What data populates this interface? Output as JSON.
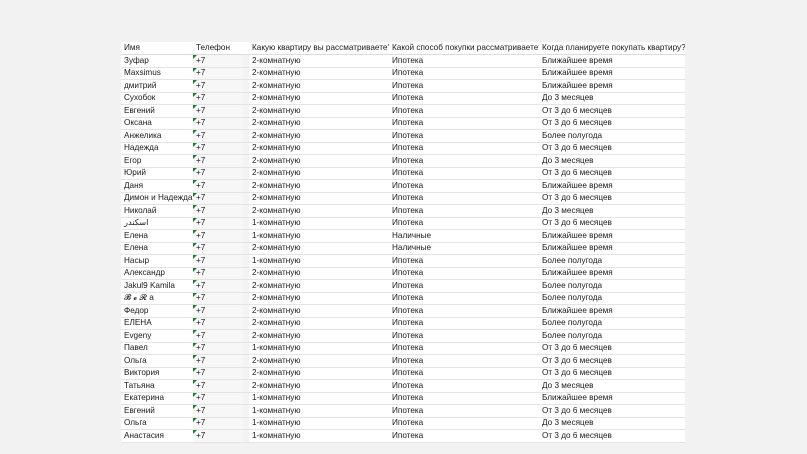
{
  "headers": {
    "name": "Имя",
    "phone": "Телефон",
    "apartment": "Какую квартиру вы рассматриваете?",
    "method": "Какой способ покупки рассматриваете?",
    "when": "Когда планируете покупать квартиру?"
  },
  "rows": [
    {
      "name": "Зуфар",
      "phone": "+7",
      "apartment": "2-комнатную",
      "method": "Ипотека",
      "when": "Ближайшее время"
    },
    {
      "name": "Maxsimus",
      "phone": "+7",
      "apartment": "2-комнатную",
      "method": "Ипотека",
      "when": "Ближайшее время"
    },
    {
      "name": "дмитрий",
      "phone": "+7",
      "apartment": "2-комнатную",
      "method": "Ипотека",
      "when": "Ближайшее время"
    },
    {
      "name": "Сухобок",
      "phone": "+7",
      "apartment": "2-комнатную",
      "method": "Ипотека",
      "when": "До 3 месяцев"
    },
    {
      "name": "Евгений",
      "phone": "+7",
      "apartment": "2-комнатную",
      "method": "Ипотека",
      "when": "От 3 до 6 месяцев"
    },
    {
      "name": "Оксана",
      "phone": "+7",
      "apartment": "2-комнатную",
      "method": "Ипотека",
      "when": "От 3 до 6 месяцев"
    },
    {
      "name": "Анжелика",
      "phone": "+7",
      "apartment": "2-комнатную",
      "method": "Ипотека",
      "when": "Более полугода"
    },
    {
      "name": "Надежда",
      "phone": "+7",
      "apartment": "2-комнатную",
      "method": "Ипотека",
      "when": "От 3 до 6 месяцев"
    },
    {
      "name": "Егор",
      "phone": "+7",
      "apartment": "2-комнатную",
      "method": "Ипотека",
      "when": "До 3 месяцев"
    },
    {
      "name": "Юрий",
      "phone": "+7",
      "apartment": "2-комнатную",
      "method": "Ипотека",
      "when": "От 3 до 6 месяцев"
    },
    {
      "name": "Даня",
      "phone": "+7",
      "apartment": "2-комнатную",
      "method": "Ипотека",
      "when": "Ближайшее время"
    },
    {
      "name": "Димон и Надежда",
      "phone": "+7",
      "apartment": "2-комнатную",
      "method": "Ипотека",
      "when": "От 3 до 6 месяцев"
    },
    {
      "name": "Николай",
      "phone": "+7",
      "apartment": "2-комнатную",
      "method": "Ипотека",
      "when": "До 3 месяцев"
    },
    {
      "name": "اسكندر",
      "phone": "+7",
      "apartment": "1-комнатную",
      "method": "Ипотека",
      "when": "От 3 до 6 месяцев",
      "rtl": true
    },
    {
      "name": "Елена",
      "phone": "+7",
      "apartment": "1-комнатную",
      "method": "Наличные",
      "when": "Ближайшее время"
    },
    {
      "name": "Елена",
      "phone": "+7",
      "apartment": "2-комнатную",
      "method": "Наличные",
      "when": "Ближайшее время"
    },
    {
      "name": "Насыр",
      "phone": "+7",
      "apartment": "1-комнатную",
      "method": "Ипотека",
      "when": "Более полугода"
    },
    {
      "name": "Александр",
      "phone": "+7",
      "apartment": "2-комнатную",
      "method": "Ипотека",
      "when": "Ближайшее время"
    },
    {
      "name": "Jakul9 Kamila",
      "phone": "+7",
      "apartment": "2-комнатную",
      "method": "Ипотека",
      "when": "Более полугода"
    },
    {
      "name": "𝓑 𝓮 𝓡 a",
      "phone": "+7",
      "apartment": "2-комнатную",
      "method": "Ипотека",
      "when": "Более полугода"
    },
    {
      "name": "Федор",
      "phone": "+7",
      "apartment": "2-комнатную",
      "method": "Ипотека",
      "when": "Ближайшее время"
    },
    {
      "name": "ЕЛЕНА",
      "phone": "+7",
      "apartment": "2-комнатную",
      "method": "Ипотека",
      "when": "Более полугода"
    },
    {
      "name": "Evgeny",
      "phone": "+7",
      "apartment": "2-комнатную",
      "method": "Ипотека",
      "when": "Более полугода"
    },
    {
      "name": "Павел",
      "phone": "+7",
      "apartment": "1-комнатную",
      "method": "Ипотека",
      "when": "От 3 до 6 месяцев"
    },
    {
      "name": "Ольга",
      "phone": "+7",
      "apartment": "2-комнатную",
      "method": "Ипотека",
      "when": "От 3 до 6 месяцев"
    },
    {
      "name": "Виктория",
      "phone": "+7",
      "apartment": "2-комнатную",
      "method": "Ипотека",
      "when": "От 3 до 6 месяцев"
    },
    {
      "name": "Татьяна",
      "phone": "+7",
      "apartment": "2-комнатную",
      "method": "Ипотека",
      "when": "До 3 месяцев"
    },
    {
      "name": "Екатерина",
      "phone": "+7",
      "apartment": "1-комнатную",
      "method": "Ипотека",
      "when": "Ближайшее время"
    },
    {
      "name": "Евгений",
      "phone": "+7",
      "apartment": "1-комнатную",
      "method": "Ипотека",
      "when": "От 3 до 6 месяцев"
    },
    {
      "name": "Ольга",
      "phone": "+7",
      "apartment": "1-комнатную",
      "method": "Ипотека",
      "when": "До 3 месяцев"
    },
    {
      "name": "Анастасия",
      "phone": "+7",
      "apartment": "1-комнатную",
      "method": "Ипотека",
      "when": "От 3 до 6 месяцев"
    }
  ]
}
